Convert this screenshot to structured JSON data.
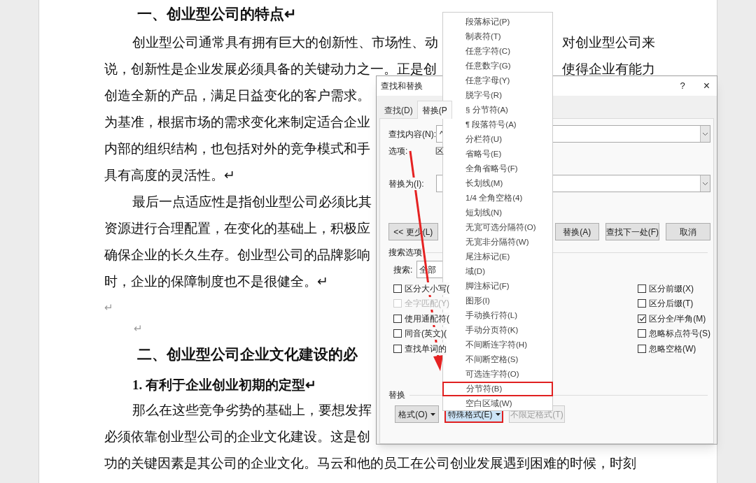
{
  "document": {
    "lines": [
      {
        "kind": "heading",
        "text": "一、创业型公司的特点↵"
      },
      {
        "kind": "first-line",
        "text": "创业型公司通常具有拥有巨大的创新性、市场性、动",
        "text_right": "对创业型公司来"
      },
      {
        "kind": "body",
        "text": "说，创新性是企业发展必须具备的关键动力之一。正是创",
        "text_right": "使得企业有能力"
      },
      {
        "kind": "body",
        "text": "创造全新的产品，满足日益变化的客户需求。"
      },
      {
        "kind": "body",
        "text": "为基准，根据市场的需求变化来制定适合企业"
      },
      {
        "kind": "body",
        "text": "内部的组织结构，也包括对外的竞争模式和手"
      },
      {
        "kind": "body",
        "text": "具有高度的灵活性。↵"
      },
      {
        "kind": "first-line",
        "text": "最后一点适应性是指创业型公司必须比其"
      },
      {
        "kind": "body",
        "text": "资源进行合理配置，在变化的基础上，积极应"
      },
      {
        "kind": "body",
        "text": "确保企业的长久生存。创业型公司的品牌影响"
      },
      {
        "kind": "body",
        "text": "时，企业的保障制度也不是很健全。↵"
      },
      {
        "kind": "mark",
        "text": "↵"
      },
      {
        "kind": "mark-indented",
        "text": "↵"
      },
      {
        "kind": "heading",
        "text": "二、创业型公司企业文化建设的必"
      },
      {
        "kind": "subheading",
        "text": "1. 有利于企业创业初期的定型↵"
      },
      {
        "kind": "first-line",
        "text": "那么在这些竞争劣势的基础上，要想发挥"
      },
      {
        "kind": "body",
        "text": "必须依靠创业型公司的企业文化建设。这是创"
      },
      {
        "kind": "body",
        "text": "功的关键因素是其公司的企业文化。马云和他的员工在公司创业发展遇到困难的时候，时刻"
      }
    ]
  },
  "dialog": {
    "title": "查找和替换",
    "help": "?",
    "close": "×",
    "tabs": [
      {
        "label": "查找(D)",
        "selected": false
      },
      {
        "label": "替换(P",
        "selected": true
      }
    ],
    "find": {
      "label": "查找内容(N):",
      "value": "^"
    },
    "options": {
      "label": "选项:",
      "value": "区"
    },
    "replace": {
      "label": "替换为(I):"
    },
    "buttons": [
      {
        "label": "<< 更少(L)"
      },
      {
        "label": "替换(A)"
      },
      {
        "label": "查找下一处(F)"
      },
      {
        "label": "取消"
      }
    ],
    "search_options": {
      "title": "搜索选项",
      "search_label": "搜索:",
      "search_value": "全部"
    },
    "checks_left": [
      {
        "label": "区分大小写(",
        "checked": false,
        "disabled": false
      },
      {
        "label": "全字匹配(Y)",
        "checked": false,
        "disabled": true
      },
      {
        "label": "使用通配符(",
        "checked": false,
        "disabled": false
      },
      {
        "label": "同音(英文)(",
        "checked": false,
        "disabled": false
      },
      {
        "label": "查找单词的",
        "checked": false,
        "disabled": false
      }
    ],
    "checks_right": [
      {
        "label": "区分前缀(X)",
        "checked": false,
        "disabled": false
      },
      {
        "label": "区分后缀(T)",
        "checked": false,
        "disabled": false
      },
      {
        "label": "区分全/半角(M)",
        "checked": true,
        "disabled": false
      },
      {
        "label": "忽略标点符号(S)",
        "checked": false,
        "disabled": false
      },
      {
        "label": "忽略空格(W)",
        "checked": false,
        "disabled": false
      }
    ],
    "replace_section": {
      "title": "替换",
      "buttons": [
        {
          "label": "格式(O)",
          "kind": "dropdown",
          "pressed": false,
          "disabled": false,
          "annotated": false
        },
        {
          "label": "特殊格式(E)",
          "kind": "dropdown",
          "pressed": true,
          "disabled": false,
          "annotated": true
        },
        {
          "label": "不限定格式(T)",
          "kind": "plain",
          "pressed": false,
          "disabled": true,
          "annotated": false
        }
      ]
    }
  },
  "menu": {
    "items": [
      {
        "label": "段落标记(P)",
        "annotated": false
      },
      {
        "label": "制表符(T)",
        "annotated": false
      },
      {
        "label": "任意字符(C)",
        "annotated": false
      },
      {
        "label": "任意数字(G)",
        "annotated": false
      },
      {
        "label": "任意字母(Y)",
        "annotated": false
      },
      {
        "label": "脱字号(R)",
        "annotated": false
      },
      {
        "label": "§ 分节符(A)",
        "annotated": false
      },
      {
        "label": "¶ 段落符号(A)",
        "annotated": false
      },
      {
        "label": "分栏符(U)",
        "annotated": false
      },
      {
        "label": "省略号(E)",
        "annotated": false
      },
      {
        "label": "全角省略号(F)",
        "annotated": false
      },
      {
        "label": "长划线(M)",
        "annotated": false
      },
      {
        "label": "1/4 全角空格(4)",
        "annotated": false
      },
      {
        "label": "短划线(N)",
        "annotated": false
      },
      {
        "label": "无宽可选分隔符(O)",
        "annotated": false
      },
      {
        "label": "无宽非分隔符(W)",
        "annotated": false
      },
      {
        "label": "尾注标记(E)",
        "annotated": false
      },
      {
        "label": "域(D)",
        "annotated": false
      },
      {
        "label": "脚注标记(F)",
        "annotated": false
      },
      {
        "label": "图形(I)",
        "annotated": false
      },
      {
        "label": "手动换行符(L)",
        "annotated": false
      },
      {
        "label": "手动分页符(K)",
        "annotated": false
      },
      {
        "label": "不间断连字符(H)",
        "annotated": false
      },
      {
        "label": "不间断空格(S)",
        "annotated": false
      },
      {
        "label": "可选连字符(O)",
        "annotated": false
      },
      {
        "label": "分节符(B)",
        "annotated": true
      },
      {
        "label": "空白区域(W)",
        "annotated": false
      }
    ]
  }
}
